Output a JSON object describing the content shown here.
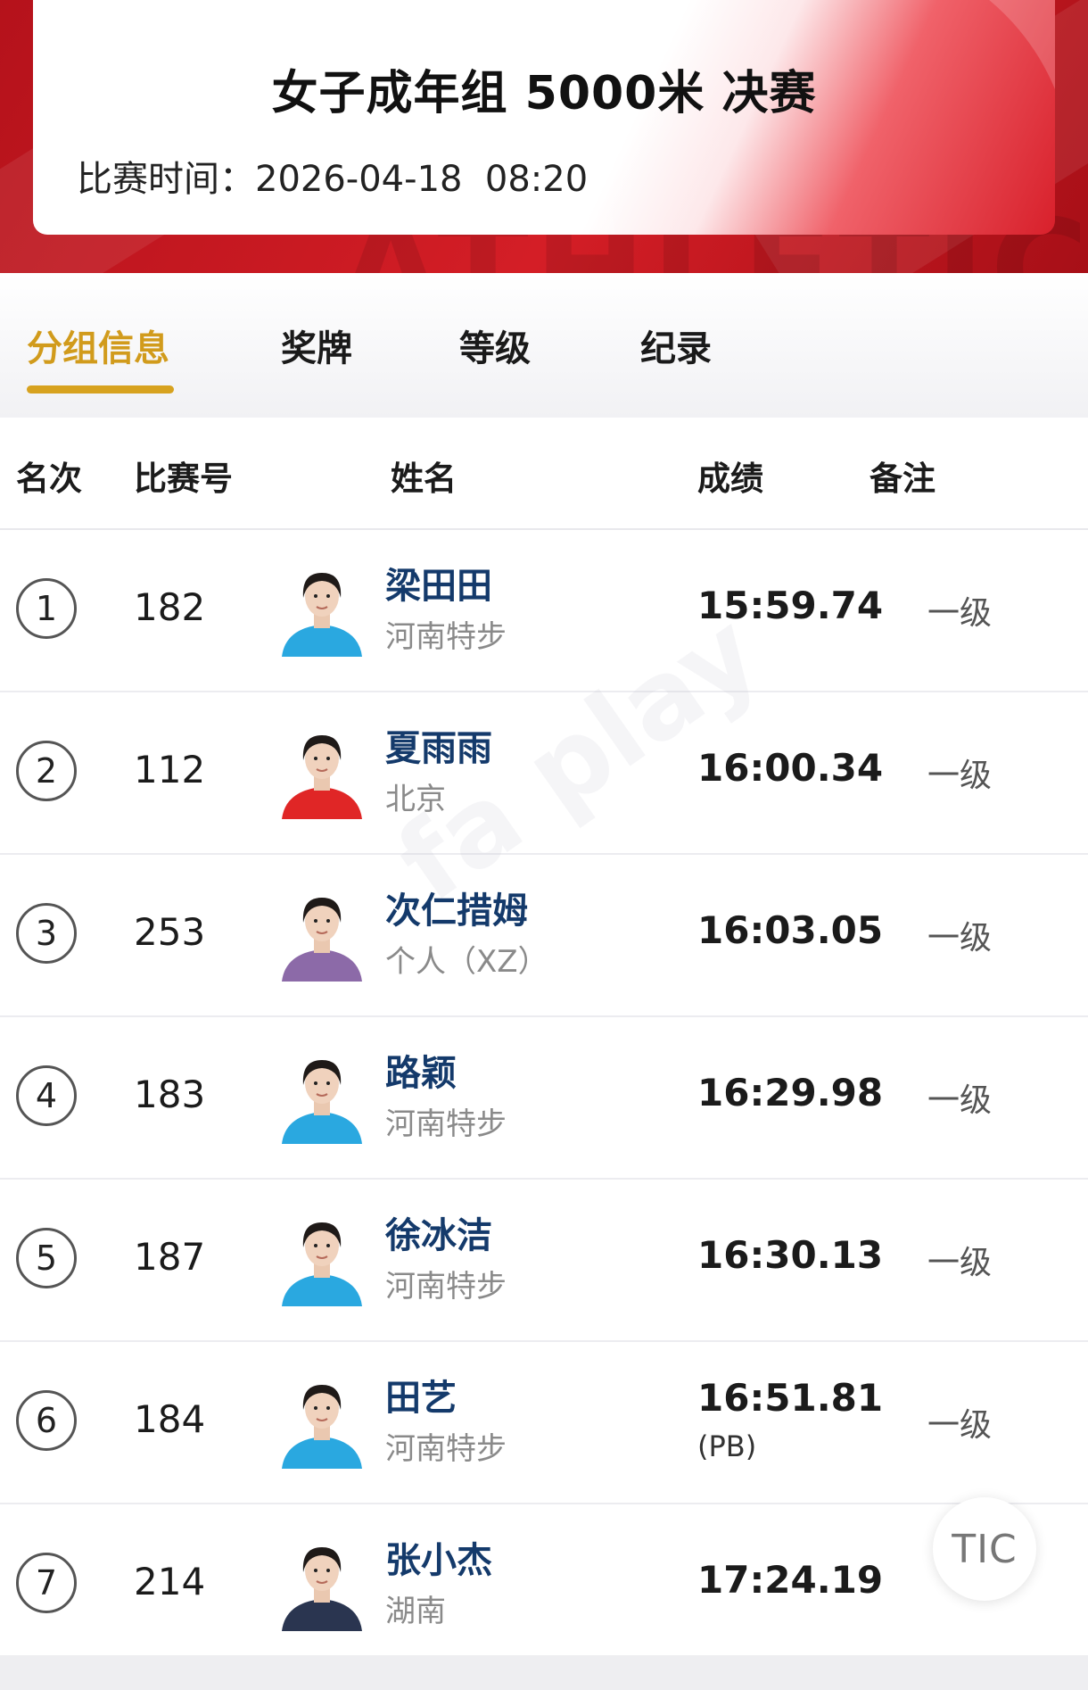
{
  "header": {
    "title": "女子成年组 5000米 决赛",
    "time_label": "比赛时间：",
    "time_value": "2026-04-18  08:20",
    "watermark_text": "ATHLETICS"
  },
  "tabs": [
    {
      "label": "分组信息",
      "active": true
    },
    {
      "label": "奖牌",
      "active": false
    },
    {
      "label": "等级",
      "active": false
    },
    {
      "label": "纪录",
      "active": false
    }
  ],
  "table": {
    "columns": [
      "名次",
      "比赛号",
      "姓名",
      "成绩",
      "备注"
    ],
    "rows": [
      {
        "rank": "1",
        "bib": "182",
        "name": "梁田田",
        "team": "河南特步",
        "result": "15:59.74",
        "extra": "",
        "note": "一级",
        "jersey": "#2aa8e0"
      },
      {
        "rank": "2",
        "bib": "112",
        "name": "夏雨雨",
        "team": "北京",
        "result": "16:00.34",
        "extra": "",
        "note": "一级",
        "jersey": "#e02626"
      },
      {
        "rank": "3",
        "bib": "253",
        "name": "次仁措姆",
        "team": "个人（XZ）",
        "result": "16:03.05",
        "extra": "",
        "note": "一级",
        "jersey": "#8c6aa8"
      },
      {
        "rank": "4",
        "bib": "183",
        "name": "路颖",
        "team": "河南特步",
        "result": "16:29.98",
        "extra": "",
        "note": "一级",
        "jersey": "#2aa8e0"
      },
      {
        "rank": "5",
        "bib": "187",
        "name": "徐冰洁",
        "team": "河南特步",
        "result": "16:30.13",
        "extra": "",
        "note": "一级",
        "jersey": "#2aa8e0"
      },
      {
        "rank": "6",
        "bib": "184",
        "name": "田艺",
        "team": "河南特步",
        "result": "16:51.81",
        "extra": "(PB)",
        "note": "一级",
        "jersey": "#2aa8e0"
      },
      {
        "rank": "7",
        "bib": "214",
        "name": "张小杰",
        "team": "湖南",
        "result": "17:24.19",
        "extra": "",
        "note": "",
        "jersey": "#2a3550"
      }
    ]
  },
  "fab": {
    "label": "TIC"
  }
}
